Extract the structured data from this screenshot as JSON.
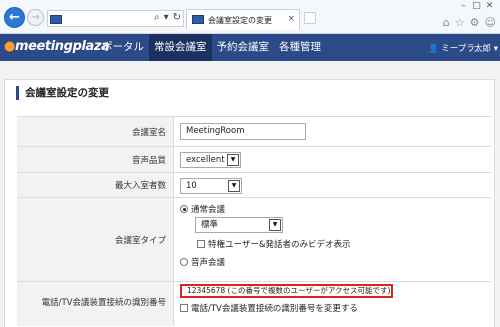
{
  "browser": {
    "tab_title": "会議室設定の変更",
    "search_icon": "search-icon",
    "refresh_icon": "refresh-icon",
    "close_glyph": "×",
    "win_minimize": "–",
    "win_maximize": "□",
    "win_close": "✕"
  },
  "app": {
    "logo_prefix": "",
    "logo_text": "meetingplaza",
    "menu": [
      {
        "label": "ポータル",
        "active": false
      },
      {
        "label": "常設会議室",
        "active": true
      },
      {
        "label": "予約会議室",
        "active": false
      },
      {
        "label": "各種管理",
        "active": false
      }
    ],
    "user_label": "ミープラ",
    "lang_label": "太郎",
    "user_icon": "person-icon",
    "accent_color": "#2b4a87",
    "active_menu_color": "#1b3261"
  },
  "page": {
    "section_title": "会議室設定の変更",
    "fields": {
      "room_name": {
        "label": "会議室名",
        "value": "MeetingRoom"
      },
      "audio_quality": {
        "label": "音声品質",
        "value": "excellent"
      },
      "max_participants": {
        "label": "最大入室者数",
        "value": "10"
      },
      "room_type": {
        "label": "会議室タイプ",
        "option_normal": "通常会議",
        "sub_select_value": "標準",
        "video_option": "特権ユーザー&発話者のみビデオ表示",
        "option_audio": "音声会議",
        "selected": "通常会議"
      },
      "phone_id": {
        "label": "電話/TV会議装置接続の識別番号",
        "value": "12345678 (この番号で複数のユーザーがアクセス可能です)",
        "change_option": "電話/TV会議装置接続の識別番号を変更する",
        "highlight_color": "#e0231f"
      }
    }
  }
}
